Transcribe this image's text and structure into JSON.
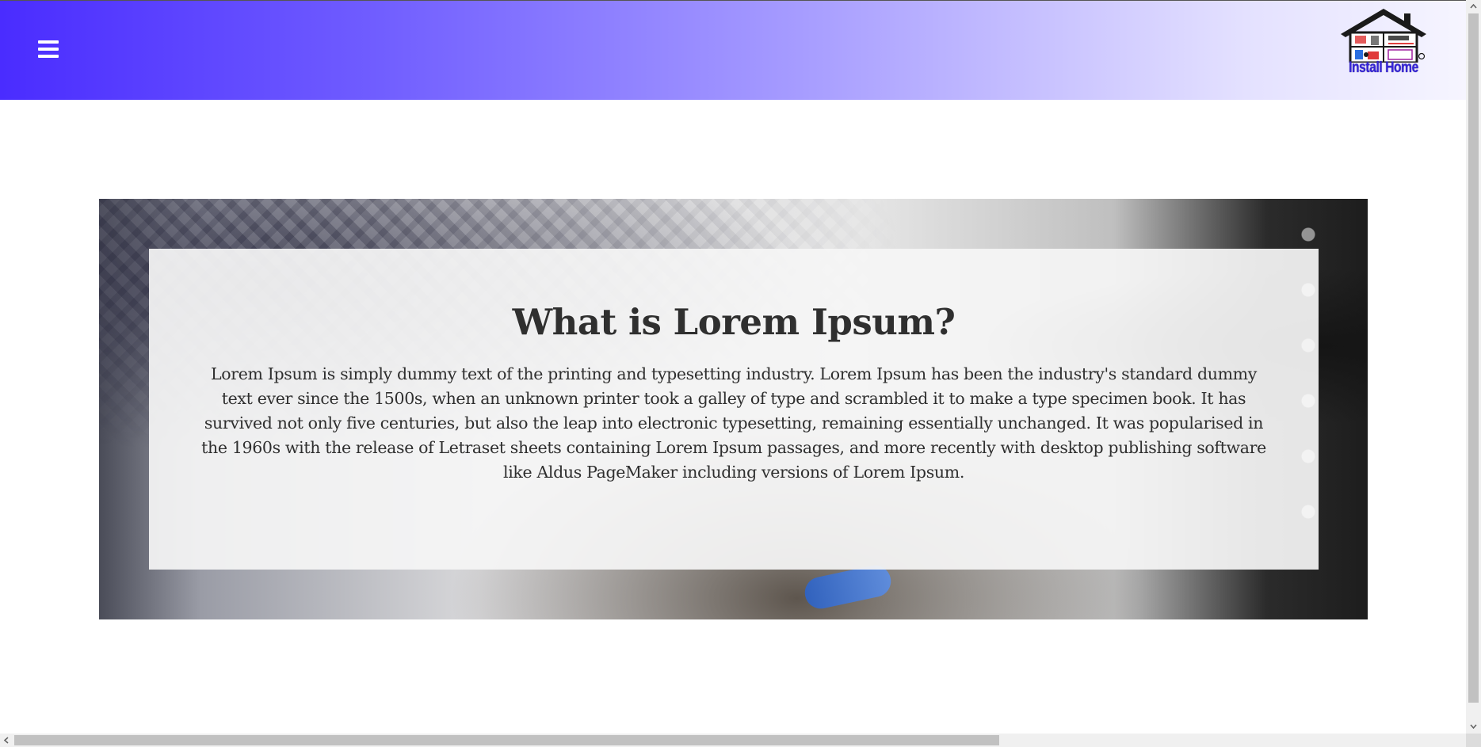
{
  "header": {
    "menu_icon": "hamburger-menu-icon",
    "logo_text": "Install Home",
    "logo_icon": "house-logo-icon",
    "gradient_start": "#4a2cff",
    "gradient_end": "#f6f5ff"
  },
  "hero": {
    "title": "What is Lorem Ipsum?",
    "text": "Lorem Ipsum is simply dummy text of the printing and typesetting industry. Lorem Ipsum has been the industry's standard dummy text ever since the 1500s, when an unknown printer took a galley of type and scrambled it to make a type specimen book. It has survived not only five centuries, but also the leap into electronic typesetting, remaining essentially unchanged. It was popularised in the 1960s with the release of Letraset sheets containing Lorem Ipsum passages, and more recently with desktop publishing software like Aldus PageMaker including versions of Lorem Ipsum.",
    "background_image": "technician-working-photo"
  },
  "scrollbars": {
    "up_icon": "scroll-up-arrow-icon",
    "down_icon": "scroll-down-arrow-icon",
    "left_icon": "scroll-left-arrow-icon"
  }
}
